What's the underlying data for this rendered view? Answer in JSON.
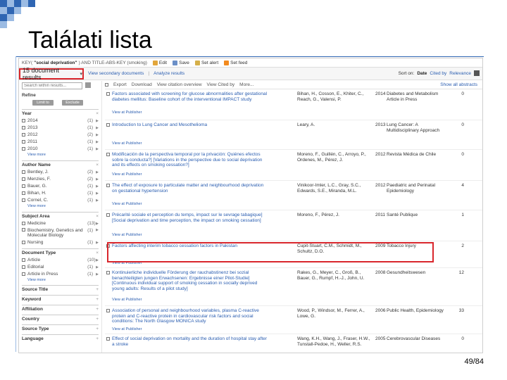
{
  "slide": {
    "title": "Találati lista",
    "page_number": "49/84",
    "accent_color": "#2f66b3",
    "highlight_color": "#d9262c"
  },
  "query_bar": {
    "prefix": "KEY(",
    "bold_term": "\"social deprivation\"",
    "rest": ") AND TITLE-ABS-KEY (smoking)",
    "tools": [
      {
        "label": "Edit",
        "icon": "pencil-icon"
      },
      {
        "label": "Save",
        "icon": "save-icon"
      },
      {
        "label": "Set alert",
        "icon": "alert-icon"
      },
      {
        "label": "Set feed",
        "icon": "rss-icon"
      }
    ]
  },
  "results_bar": {
    "count_label": "15 document results",
    "links": [
      "View secondary documents",
      "Analyze results"
    ],
    "sort_label": "Sort on:",
    "sort_options": [
      "Date",
      "Cited by",
      "Relevance"
    ]
  },
  "sidebar": {
    "search_placeholder": "Search within results...",
    "refine_label": "Refine",
    "limit_label": "Limit to",
    "exclude_label": "Exclude",
    "facets": [
      {
        "title": "Year",
        "items": [
          {
            "label": "2014",
            "count": "(1)"
          },
          {
            "label": "2013",
            "count": "(1)"
          },
          {
            "label": "2012",
            "count": "(2)"
          },
          {
            "label": "2011",
            "count": "(1)"
          },
          {
            "label": "2010",
            "count": "(1)"
          }
        ],
        "more": "View more"
      },
      {
        "title": "Author Name",
        "items": [
          {
            "label": "Bentley, J.",
            "count": "(2)"
          },
          {
            "label": "Menzies, F.",
            "count": "(2)"
          },
          {
            "label": "Bauer, G.",
            "count": "(1)"
          },
          {
            "label": "Bihan, H.",
            "count": "(1)"
          },
          {
            "label": "Cornel, C.",
            "count": "(1)"
          }
        ],
        "more": "View more"
      },
      {
        "title": "Subject Area",
        "items": [
          {
            "label": "Medicine",
            "count": "(13)"
          },
          {
            "label": "Biochemistry, Genetics and Molecular Biology",
            "count": "(1)"
          },
          {
            "label": "Nursing",
            "count": "(1)"
          }
        ],
        "more": ""
      },
      {
        "title": "Document Type",
        "items": [
          {
            "label": "Article",
            "count": "(10)"
          },
          {
            "label": "Editorial",
            "count": "(1)"
          },
          {
            "label": "Article in Press",
            "count": "(1)"
          }
        ],
        "more": "View more"
      }
    ],
    "collapsed": [
      "Source Title",
      "Keyword",
      "Affiliation",
      "Country",
      "Source Type",
      "Language"
    ]
  },
  "action_bar": {
    "items": [
      "Export",
      "Download",
      "View citation overview",
      "View Cited by",
      "More..."
    ],
    "right": "Show all abstracts"
  },
  "results": [
    {
      "title": "Factors associated with screening for glucose abnormalities after gestational diabetes mellitus: Baseline cohort of the interventional IMPACT study",
      "authors": "Bihan, H., Cosson, E., Khiter, C., Reach, G., Valensi, P.",
      "year": "2014",
      "source": "Diabetes and Metabolism Article in Press",
      "cited": "0",
      "view": "View at Publisher"
    },
    {
      "title": "Introduction to Lung Cancer and Mesothelioma",
      "authors": "Leary, A.",
      "year": "2013",
      "source": "Lung Cancer: A Multidisciplinary Approach",
      "cited": "0",
      "view": "View at Publisher"
    },
    {
      "title": "Modificación de la perspectiva temporal por la privación: Quiénes efectos sobre la conducta?] [Variations in the perspective due to social deprivation and its effects on smoking cessation?]",
      "authors": "Moreno, F., Guillén, C., Arroyo, P., Ordenes, M., Pérez, J.",
      "year": "2012",
      "source": "Revista Médica de Chile",
      "cited": "0",
      "view": "View at Publisher"
    },
    {
      "title": "The effect of exposure to particulate matter and neighbourhood deprivation on gestational hypertension",
      "authors": "Vinikoor-Imler, L.C., Gray, S.C., Edwards, S.E., Miranda, M.L.",
      "year": "2012",
      "source": "Paediatric and Perinatal Epidemiology",
      "cited": "4",
      "view": "View at Publisher"
    },
    {
      "title": "Précarité sociale et perception du temps, impact sur le sevrage tabagique] [Social deprivation and time perception, the impact on smoking cessation]",
      "authors": "Moreno, F., Pérez, J.",
      "year": "2011",
      "source": "Santé Publique",
      "cited": "1",
      "view": "View at Publisher"
    },
    {
      "title": "Factors affecting interim tobacco cessation factors in Pakistan",
      "authors": "Cupit-Stuart, C.M., Schmidt, M., Schultz, D.O.",
      "year": "2009",
      "source": "Tobacco Injury",
      "cited": "2",
      "view": "View at Publisher"
    },
    {
      "title": "Kontinuierliche individuelle Förderung der rauchabstinenz bei sozial benachteiligten jungen Erwachsenen: Ergebnisse einer Pilot-Studie] [Continuous individual support of smoking cessation in socially deprived young adults: Results of a pilot study]",
      "authors": "Rakes, G., Meyer, C., Groß, B., Bauer, G., Rumpf, H.-J., John, U.",
      "year": "2008",
      "source": "Gesundheitswesen",
      "cited": "12",
      "view": "View at Publisher"
    },
    {
      "title": "Association of personal and neighbourhood variables, plasma C-reactive protein and C-reactive protein in cardiovascular risk factors and social conditions: The North Glasgow MONICA study",
      "authors": "Wood, P., Windsor, M., Ferrer, A., Lowe, G.",
      "year": "2006",
      "source": "Public Health, Epidemiology",
      "cited": "33",
      "view": "View at Publisher"
    },
    {
      "title": "Effect of social deprivation on mortality and the duration of hospital stay after a stroke",
      "authors": "Wang, K.H., Wang, J., Fraser, H.W., Tunstall-Pedoe, H., Weller, R.S.",
      "year": "2005",
      "source": "Cerebrovascular Diseases",
      "cited": "0",
      "view": ""
    }
  ]
}
